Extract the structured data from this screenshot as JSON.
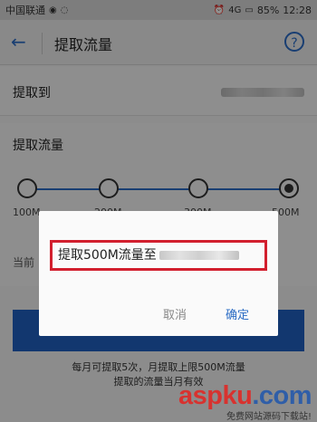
{
  "status_bar": {
    "carrier": "中国联通",
    "icons": [
      "signal-icon",
      "wifi-icon",
      "alarm-icon",
      "network-icon"
    ],
    "battery": "85%",
    "time": "12:28"
  },
  "header": {
    "title": "提取流量",
    "back_icon": "back-arrow-icon",
    "help_icon": "help-icon"
  },
  "fields": {
    "extract_to_label": "提取到",
    "extract_amount_label": "提取流量",
    "current_label": "当前"
  },
  "amounts": [
    "100M",
    "200M",
    "300M",
    "500M"
  ],
  "selected_amount": "500M",
  "footer": {
    "line1": "每月可提取5次，月提取上限500M流量",
    "line2": "提取的流量当月有效"
  },
  "dialog": {
    "message": "提取500M流量至",
    "cancel": "取消",
    "confirm": "确定"
  },
  "watermark": {
    "main": "aspku",
    "tld": ".com",
    "sub": "免费网站源码下载站!"
  },
  "colors": {
    "accent": "#2b6cc4",
    "highlight": "#d21f2e"
  }
}
